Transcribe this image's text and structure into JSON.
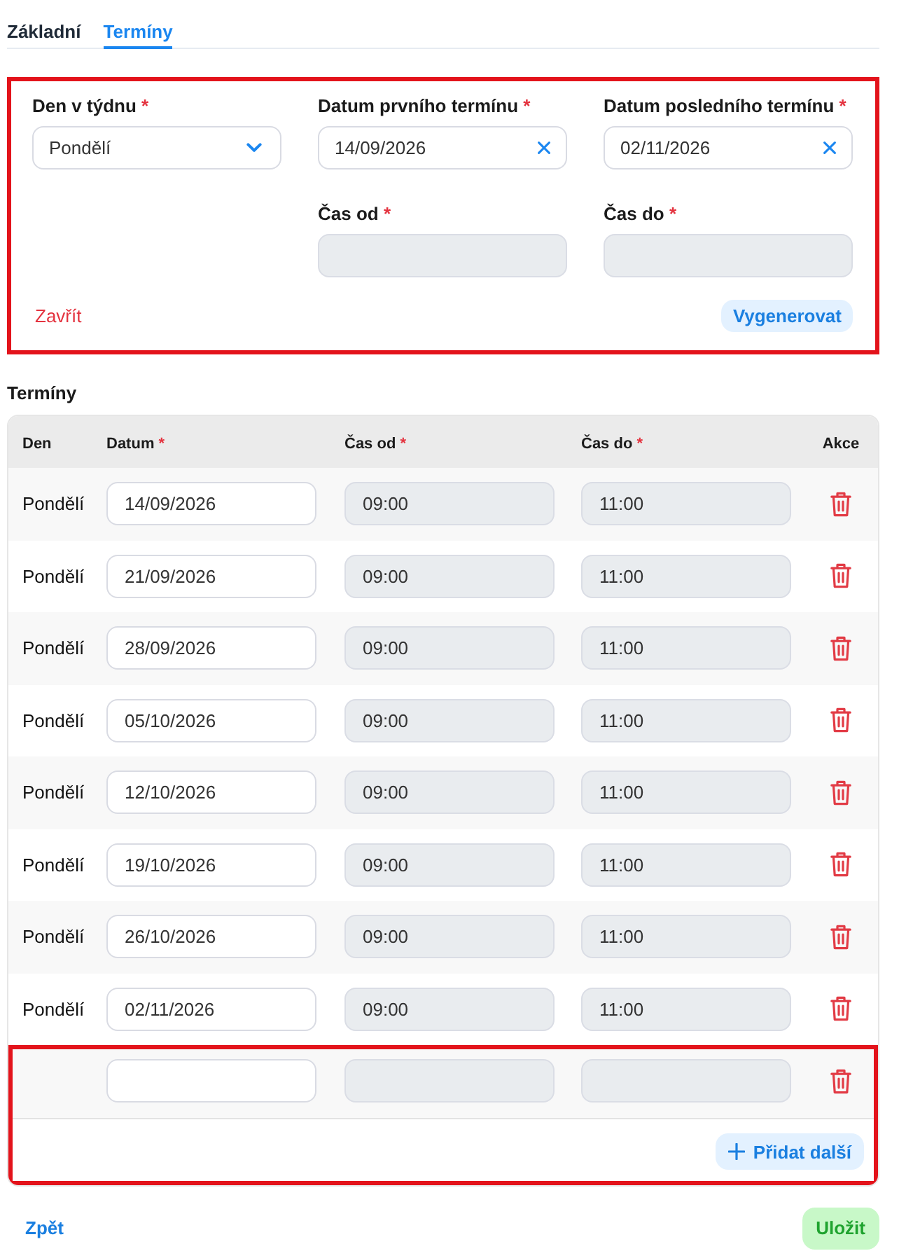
{
  "tabs": [
    {
      "label": "Základní",
      "selected": false
    },
    {
      "label": "Termíny",
      "selected": true
    }
  ],
  "generator": {
    "highlighted": true,
    "field_rows": [
      [
        {
          "kind": "select",
          "label": "Den v týdnu",
          "required_mark": "*",
          "value": "Pondělí",
          "disabled": false
        },
        {
          "kind": "date",
          "label": "Datum prvního termínu",
          "required_mark": "*",
          "value": "14/09/2026",
          "disabled": false
        },
        {
          "kind": "date",
          "label": "Datum posledního termínu",
          "required_mark": "*",
          "value": "02/11/2026",
          "disabled": false
        }
      ],
      [
        {
          "kind": "time",
          "label": "Čas od",
          "required_mark": "*",
          "disabled": true
        },
        {
          "kind": "time",
          "label": "Čas do",
          "required_mark": "*",
          "disabled": true
        }
      ]
    ],
    "close_link": "Zavřít",
    "generate_button": "Vygenerovat"
  },
  "section_title": "Termíny",
  "table": {
    "columns": [
      {
        "kind": "day",
        "label": "Den"
      },
      {
        "kind": "date",
        "label": "Datum",
        "required_mark": "*",
        "disabled": false
      },
      {
        "kind": "time_from",
        "label": "Čas od",
        "required_mark": "*",
        "disabled": true
      },
      {
        "kind": "time_to",
        "label": "Čas do",
        "required_mark": "*",
        "disabled": true
      },
      {
        "kind": "actions",
        "label": "Akce"
      }
    ],
    "rows": [
      {
        "day": "Pondělí",
        "date": "14/09/2026",
        "time_from": "09:00",
        "time_to": "11:00",
        "highlighted": false
      },
      {
        "day": "Pondělí",
        "date": "21/09/2026",
        "time_from": "09:00",
        "time_to": "11:00",
        "highlighted": false
      },
      {
        "day": "Pondělí",
        "date": "28/09/2026",
        "time_from": "09:00",
        "time_to": "11:00",
        "highlighted": false
      },
      {
        "day": "Pondělí",
        "date": "05/10/2026",
        "time_from": "09:00",
        "time_to": "11:00",
        "highlighted": false
      },
      {
        "day": "Pondělí",
        "date": "12/10/2026",
        "time_from": "09:00",
        "time_to": "11:00",
        "highlighted": false
      },
      {
        "day": "Pondělí",
        "date": "19/10/2026",
        "time_from": "09:00",
        "time_to": "11:00",
        "highlighted": false
      },
      {
        "day": "Pondělí",
        "date": "26/10/2026",
        "time_from": "09:00",
        "time_to": "11:00",
        "highlighted": false
      },
      {
        "day": "Pondělí",
        "date": "02/11/2026",
        "time_from": "09:00",
        "time_to": "11:00",
        "highlighted": false
      },
      {
        "highlighted": true
      }
    ],
    "add_row": {
      "label": "Přidat další",
      "highlighted": true
    }
  },
  "footer": {
    "back_link": "Zpět",
    "save_button": "Uložit"
  }
}
